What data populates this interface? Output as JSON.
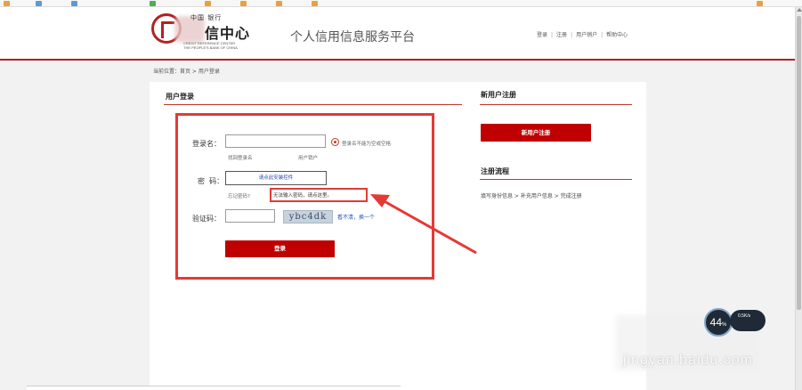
{
  "header": {
    "logo_bank": "中国 银行",
    "logo_chars": "信中心",
    "logo_en1": "CREDIT REFERENCE CENTER",
    "logo_en2": "THE PEOPLE'S BANK OF CHINA",
    "site_title": "个人信用信息服务平台",
    "nav": [
      "登录",
      "注册",
      "用户销户",
      "帮助中心"
    ]
  },
  "breadcrumb": "当前位置：首页 > 用户登录",
  "login": {
    "section_title": "用户登录",
    "username_label": "登录名：",
    "username_value": "",
    "username_hint": "登录名不能为空或空格",
    "find_username": "找回登录名",
    "deactivate": "用户销户",
    "password_label": "密  码：",
    "password_control": "请点此安装控件",
    "forgot_password": "忘记密码?",
    "password_note": "无法输入密码，请点这里。",
    "captcha_label": "验证码：",
    "captcha_value": "",
    "captcha_image_text": "ybc4dk",
    "captcha_refresh": "看不清，换一个",
    "submit": "登录"
  },
  "register": {
    "section_title": "新用户注册",
    "button": "新用户注册",
    "flow_title": "注册流程",
    "flow_text": "填写身份信息 > 补充用户信息 > 完成注册"
  },
  "overlay": {
    "speed_value": "44",
    "speed_unit": "%",
    "speed_up": "0.5K/s",
    "speed_down": "",
    "watermark": "jingyan.baidu.com"
  },
  "colors": {
    "brand_red": "#c00000",
    "annotation_red": "#e53935",
    "header_rule": "#b22222",
    "link_blue": "#2a52be"
  }
}
